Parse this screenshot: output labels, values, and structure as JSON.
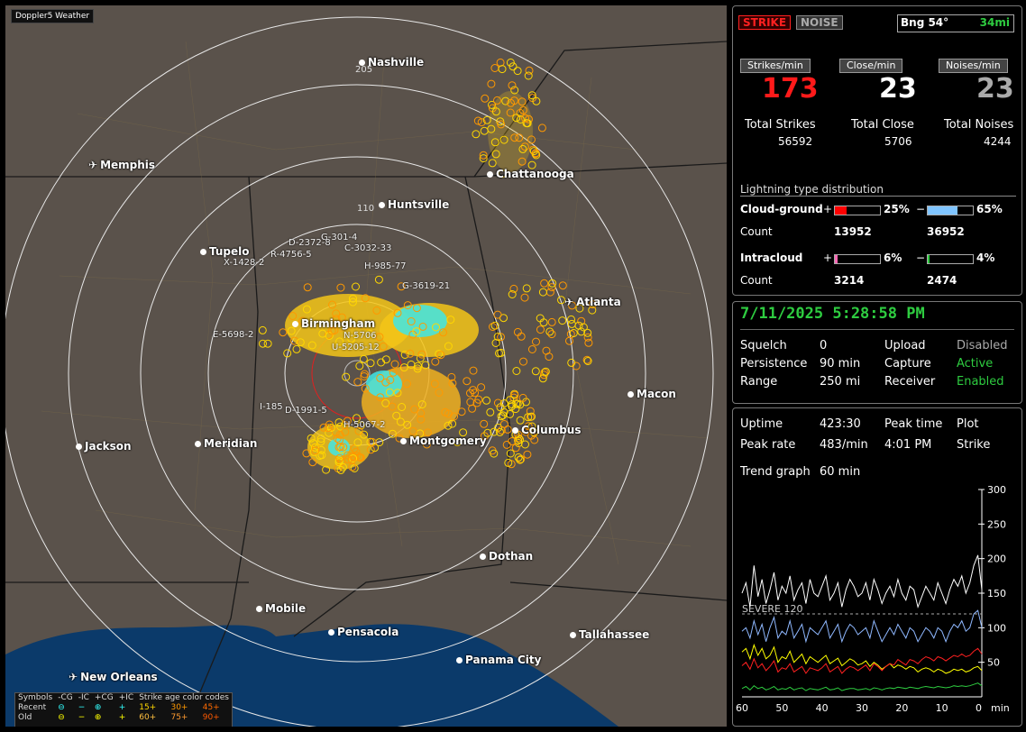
{
  "app_title": "Doppler5 Weather",
  "cities": [
    {
      "name": "Nashville",
      "kind": "city"
    },
    {
      "name": "Memphis",
      "kind": "airport"
    },
    {
      "name": "Chattanooga",
      "kind": "city"
    },
    {
      "name": "Huntsville",
      "kind": "city"
    },
    {
      "name": "Tupelo",
      "kind": "city"
    },
    {
      "name": "Atlanta",
      "kind": "airport"
    },
    {
      "name": "Birmingham",
      "kind": "city"
    },
    {
      "name": "Macon",
      "kind": "city"
    },
    {
      "name": "Jackson",
      "kind": "city"
    },
    {
      "name": "Meridian",
      "kind": "city"
    },
    {
      "name": "Montgomery",
      "kind": "city"
    },
    {
      "name": "Columbus",
      "kind": "city"
    },
    {
      "name": "Dothan",
      "kind": "city"
    },
    {
      "name": "Mobile",
      "kind": "city"
    },
    {
      "name": "Pensacola",
      "kind": "city"
    },
    {
      "name": "Tallahassee",
      "kind": "city"
    },
    {
      "name": "Panama City",
      "kind": "city"
    },
    {
      "name": "New Orleans",
      "kind": "airport"
    }
  ],
  "highways": [
    "205",
    "110"
  ],
  "storm_labels": [
    "G-301-4",
    "D-2372-8",
    "C-3032-33",
    "R-4756-5",
    "X-1428-2",
    "H-985-77",
    "G-3619-21",
    "N-5706",
    "U-5205-12",
    "E-5698-2",
    "I-185",
    "D-1991-5",
    "H-5067-2"
  ],
  "legend": {
    "row0": [
      "Symbols",
      "-CG",
      "-IC",
      "+CG",
      "+IC",
      "Strike age color codes"
    ],
    "row1": [
      "Recent",
      "⊖",
      "−",
      "⊕",
      "+",
      "15+",
      "30+",
      "45+"
    ],
    "row2": [
      "Old",
      "⊖",
      "−",
      "⊕",
      "+",
      "60+",
      "75+",
      "90+"
    ],
    "age_colors": [
      "#ffd700",
      "#ff9900",
      "#ff6a00",
      "#ffc040",
      "#ff9a30",
      "#ff5a00"
    ]
  },
  "status": {
    "strike_btn": "STRIKE",
    "noise_btn": "NOISE",
    "bearing": "Bng 54°",
    "distance": "34mi",
    "strikes_per_min_label": "Strikes/min",
    "close_per_min_label": "Close/min",
    "noises_per_min_label": "Noises/min",
    "strikes_per_min": "173",
    "close_per_min": "23",
    "noises_per_min": "23",
    "total_strikes_label": "Total Strikes",
    "total_close_label": "Total Close",
    "total_noises_label": "Total Noises",
    "total_strikes": "56592",
    "total_close": "5706",
    "total_noises": "4244",
    "dist_title": "Lightning type distribution",
    "cg_label": "Cloud-ground",
    "ic_label": "Intracloud",
    "count_label": "Count",
    "plus": "+",
    "minus": "−",
    "cg_plus_pct": "25%",
    "cg_minus_pct": "65%",
    "cg_plus_count": "13952",
    "cg_minus_count": "36952",
    "ic_plus_pct": "6%",
    "ic_minus_pct": "4%",
    "ic_plus_count": "3214",
    "ic_minus_count": "2474",
    "cg_plus_frac": 0.25,
    "cg_minus_frac": 0.65,
    "ic_plus_frac": 0.06,
    "ic_minus_frac": 0.04,
    "colors": {
      "cg_plus": "#ff0000",
      "cg_minus": "#7fc4ff",
      "ic_plus": "#ff69b4",
      "ic_minus": "#2ecc40"
    }
  },
  "settings": {
    "datetime": "7/11/2025 5:28:58 PM",
    "squelch_label": "Squelch",
    "squelch": "0",
    "persistence_label": "Persistence",
    "persistence": "90 min",
    "range_label": "Range",
    "range": "250 mi",
    "upload_label": "Upload",
    "upload": "Disabled",
    "capture_label": "Capture",
    "capture": "Active",
    "receiver_label": "Receiver",
    "receiver": "Enabled"
  },
  "trend": {
    "uptime_label": "Uptime",
    "uptime": "423:30",
    "peak_time_label": "Peak time",
    "peak_time": "4:01 PM",
    "plot_label": "Plot",
    "plot": "Strike",
    "peak_rate_label": "Peak rate",
    "peak_rate": "483/min",
    "trend_label": "Trend graph",
    "trend_value": "60 min",
    "severe_label": "SEVERE 120",
    "y_ticks": [
      "300",
      "250",
      "200",
      "150",
      "100",
      "50"
    ],
    "x_ticks": [
      "60",
      "50",
      "40",
      "30",
      "20",
      "10",
      "0"
    ],
    "x_unit": "min"
  },
  "chart_data": {
    "type": "line",
    "title": "",
    "xlabel": "min",
    "ylabel": "",
    "x_range": [
      60,
      0
    ],
    "ylim": [
      0,
      300
    ],
    "severe_threshold": 120,
    "series": [
      {
        "color": "#ffffff",
        "values": [
          150,
          165,
          130,
          190,
          145,
          170,
          135,
          155,
          180,
          140,
          160,
          150,
          175,
          140,
          155,
          165,
          135,
          170,
          150,
          145,
          160,
          175,
          140,
          150,
          165,
          130,
          155,
          170,
          160,
          145,
          150,
          165,
          140,
          170,
          155,
          135,
          150,
          160,
          145,
          170,
          150,
          140,
          160,
          155,
          130,
          145,
          160,
          150,
          140,
          165,
          150,
          135,
          155,
          170,
          160,
          175,
          150,
          165,
          190,
          205,
          155
        ]
      },
      {
        "color": "#8fb8ff",
        "values": [
          95,
          100,
          85,
          110,
          90,
          105,
          80,
          100,
          115,
          85,
          95,
          90,
          110,
          85,
          95,
          105,
          80,
          100,
          95,
          90,
          100,
          110,
          85,
          95,
          105,
          80,
          95,
          105,
          100,
          90,
          95,
          100,
          85,
          110,
          95,
          80,
          90,
          100,
          90,
          105,
          95,
          85,
          100,
          95,
          80,
          90,
          100,
          95,
          85,
          100,
          95,
          80,
          95,
          105,
          100,
          110,
          95,
          100,
          120,
          125,
          100
        ]
      },
      {
        "color": "#ffff00",
        "values": [
          65,
          70,
          55,
          75,
          60,
          70,
          55,
          60,
          72,
          50,
          58,
          55,
          66,
          50,
          56,
          62,
          48,
          58,
          54,
          50,
          55,
          60,
          48,
          52,
          56,
          45,
          50,
          55,
          52,
          46,
          48,
          52,
          44,
          50,
          46,
          40,
          44,
          48,
          42,
          46,
          44,
          40,
          44,
          42,
          36,
          40,
          42,
          40,
          36,
          40,
          38,
          34,
          36,
          40,
          38,
          40,
          36,
          38,
          42,
          44,
          38
        ]
      },
      {
        "color": "#ff2020",
        "values": [
          45,
          50,
          40,
          55,
          42,
          48,
          38,
          44,
          52,
          36,
          42,
          40,
          48,
          36,
          40,
          44,
          34,
          42,
          40,
          38,
          42,
          48,
          36,
          40,
          44,
          34,
          40,
          44,
          42,
          38,
          42,
          46,
          38,
          48,
          44,
          38,
          44,
          48,
          46,
          54,
          50,
          46,
          54,
          52,
          48,
          54,
          58,
          56,
          52,
          58,
          56,
          52,
          56,
          60,
          58,
          62,
          58,
          60,
          66,
          70,
          62
        ]
      },
      {
        "color": "#2ecc40",
        "values": [
          12,
          15,
          10,
          16,
          12,
          14,
          10,
          12,
          15,
          10,
          12,
          11,
          14,
          10,
          12,
          13,
          9,
          12,
          11,
          10,
          12,
          14,
          10,
          11,
          13,
          9,
          11,
          12,
          12,
          10,
          11,
          12,
          10,
          13,
          12,
          10,
          12,
          13,
          12,
          14,
          13,
          12,
          14,
          13,
          12,
          14,
          15,
          14,
          13,
          15,
          14,
          13,
          14,
          16,
          15,
          16,
          15,
          16,
          18,
          20,
          16
        ]
      }
    ]
  }
}
